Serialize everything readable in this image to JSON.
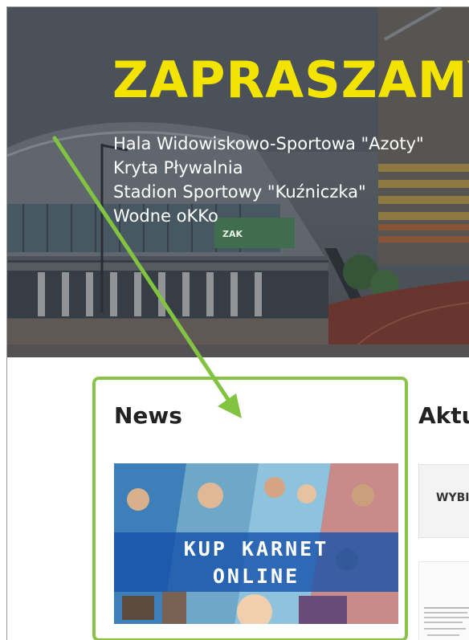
{
  "hero": {
    "title": "ZAPRASZAMY",
    "venues": [
      "Hala Widowiskowo-Sportowa \"Azoty\"",
      "Kryta Pływalnia",
      "Stadion Sportowy \"Kuźniczka\"",
      "Wodne oKKo"
    ],
    "building_sign": "ZAK"
  },
  "news": {
    "heading": "News",
    "promo": {
      "line1": "KUP KARNET",
      "line2": "ONLINE"
    }
  },
  "aktualnosci": {
    "heading": "Aktu",
    "card_title": "WYBI"
  },
  "colors": {
    "title_yellow": "#f2e400",
    "highlight_green": "#8bc34a",
    "promo_band": "#1450aa"
  },
  "icons": [
    "annotation-arrow-icon"
  ]
}
